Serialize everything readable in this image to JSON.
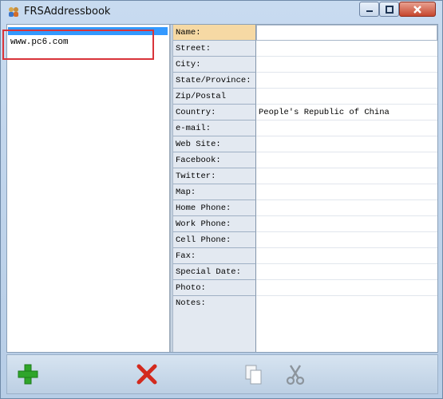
{
  "window": {
    "title": "FRSAddressbook"
  },
  "list": {
    "items": [
      "www.pc6.com"
    ]
  },
  "fields": [
    {
      "label": "Name:",
      "value": ""
    },
    {
      "label": "Street:",
      "value": ""
    },
    {
      "label": "City:",
      "value": ""
    },
    {
      "label": "State/Province:",
      "value": ""
    },
    {
      "label": "Zip/Postal Code:",
      "value": ""
    },
    {
      "label": "Country:",
      "value": "People's Republic of China"
    },
    {
      "label": "e-mail:",
      "value": ""
    },
    {
      "label": "Web Site:",
      "value": ""
    },
    {
      "label": "Facebook:",
      "value": ""
    },
    {
      "label": "Twitter:",
      "value": ""
    },
    {
      "label": "Map:",
      "value": ""
    },
    {
      "label": "Home Phone:",
      "value": ""
    },
    {
      "label": "Work Phone:",
      "value": ""
    },
    {
      "label": "Cell Phone:",
      "value": ""
    },
    {
      "label": "Fax:",
      "value": ""
    },
    {
      "label": "Special Date:",
      "value": ""
    },
    {
      "label": "Photo:",
      "value": ""
    }
  ],
  "notes": {
    "label": "Notes:"
  },
  "toolbar": {
    "icons": [
      "add-icon",
      "delete-icon",
      "copy-icon",
      "cut-icon"
    ],
    "colors": {
      "add": "#2fa52a",
      "delete": "#d32a1e"
    }
  }
}
